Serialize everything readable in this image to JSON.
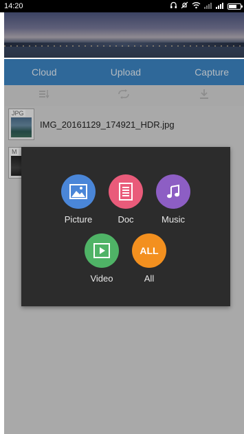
{
  "status_bar": {
    "time": "14:20"
  },
  "tabs": [
    {
      "label": "Cloud"
    },
    {
      "label": "Upload"
    },
    {
      "label": "Capture"
    }
  ],
  "files": [
    {
      "tag": "JPG",
      "name": "IMG_20161129_174921_HDR.jpg"
    },
    {
      "tag": "M",
      "name": ""
    }
  ],
  "popup": {
    "options": [
      {
        "label": "Picture",
        "color": "#4a86d8",
        "icon": "picture-icon"
      },
      {
        "label": "Doc",
        "color": "#e95b7a",
        "icon": "doc-icon"
      },
      {
        "label": "Music",
        "color": "#8d5ec4",
        "icon": "music-icon"
      },
      {
        "label": "Video",
        "color": "#4fb366",
        "icon": "video-icon"
      },
      {
        "label": "All",
        "color": "#f3901f",
        "icon": "all-icon",
        "icon_text": "ALL"
      }
    ]
  }
}
